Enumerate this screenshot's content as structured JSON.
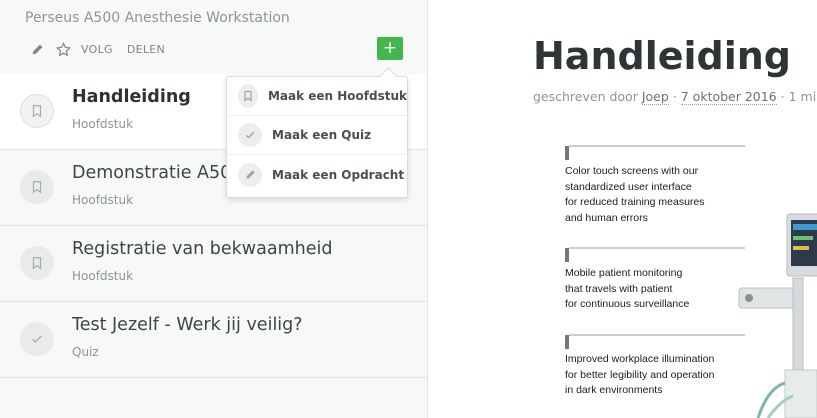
{
  "sidebar": {
    "course_title": "Perseus A500 Anesthesie Workstation",
    "actions": {
      "follow": "VOLG",
      "share": "DELEN"
    },
    "add_button": "+",
    "chapters": [
      {
        "title": "Handleiding",
        "type": "Hoofdstuk",
        "icon": "bookmark-icon"
      },
      {
        "title": "Demonstratie A500",
        "type": "Hoofdstuk",
        "icon": "bookmark-icon"
      },
      {
        "title": "Registratie van bekwaamheid",
        "type": "Hoofdstuk",
        "icon": "bookmark-icon"
      },
      {
        "title": "Test Jezelf - Werk jij veilig?",
        "type": "Quiz",
        "icon": "check-icon"
      }
    ]
  },
  "dropdown": {
    "items": [
      {
        "label": "Maak een Hoofdstuk",
        "icon": "bookmark-icon"
      },
      {
        "label": "Maak een Quiz",
        "icon": "check-icon"
      },
      {
        "label": "Maak een Opdracht",
        "icon": "pencil-icon"
      }
    ]
  },
  "main": {
    "title": "Handleiding",
    "meta": {
      "prefix": "geschreven door",
      "author": "Joep",
      "separator": "·",
      "date": "7 oktober 2016",
      "reading": "1 mi"
    },
    "figure": {
      "captions": [
        "Color touch screens with our\nstandardized user interface\nfor reduced training measures\nand human errors",
        "Mobile patient monitoring\nthat travels with patient\nfor continuous surveillance",
        "Improved workplace illumination\nfor better legibility and operation\nin dark environments"
      ]
    }
  },
  "colors": {
    "accent_green": "#43b64f",
    "sidebar_bg": "#f7f8f8"
  }
}
